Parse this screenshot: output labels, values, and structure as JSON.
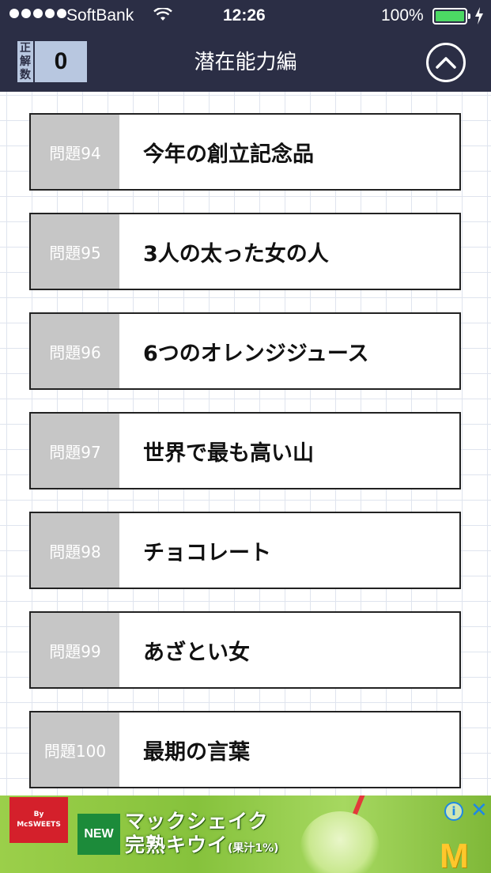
{
  "status_bar": {
    "carrier": "SoftBank",
    "time": "12:26",
    "battery_percent": "100%",
    "battery_level": 1.0
  },
  "nav": {
    "score_label": [
      "正",
      "解",
      "数"
    ],
    "score_value": "0",
    "title": "潜在能力編"
  },
  "questions": [
    {
      "number": "問題94",
      "title": "今年の創立記念品"
    },
    {
      "number": "問題95",
      "title": "3人の太った女の人"
    },
    {
      "number": "問題96",
      "title": "6つのオレンジジュース"
    },
    {
      "number": "問題97",
      "title": "世界で最も高い山"
    },
    {
      "number": "問題98",
      "title": "チョコレート"
    },
    {
      "number": "問題99",
      "title": "あざとい女"
    },
    {
      "number": "問題100",
      "title": "最期の言葉"
    }
  ],
  "ad": {
    "brand_line1": "By",
    "brand_line2": "McSWEETS",
    "new_badge": "NEW",
    "headline_line1": "マックシェイク",
    "headline_line2": "完熟キウイ",
    "headline_note": "(果汁1%)",
    "info_icon": "i",
    "close_icon": "✕",
    "logo": "M"
  },
  "colors": {
    "navbar": "#2b2e45",
    "score_bg": "#b8c7e0",
    "question_number_bg": "#c6c6c6",
    "battery": "#4cd964"
  }
}
